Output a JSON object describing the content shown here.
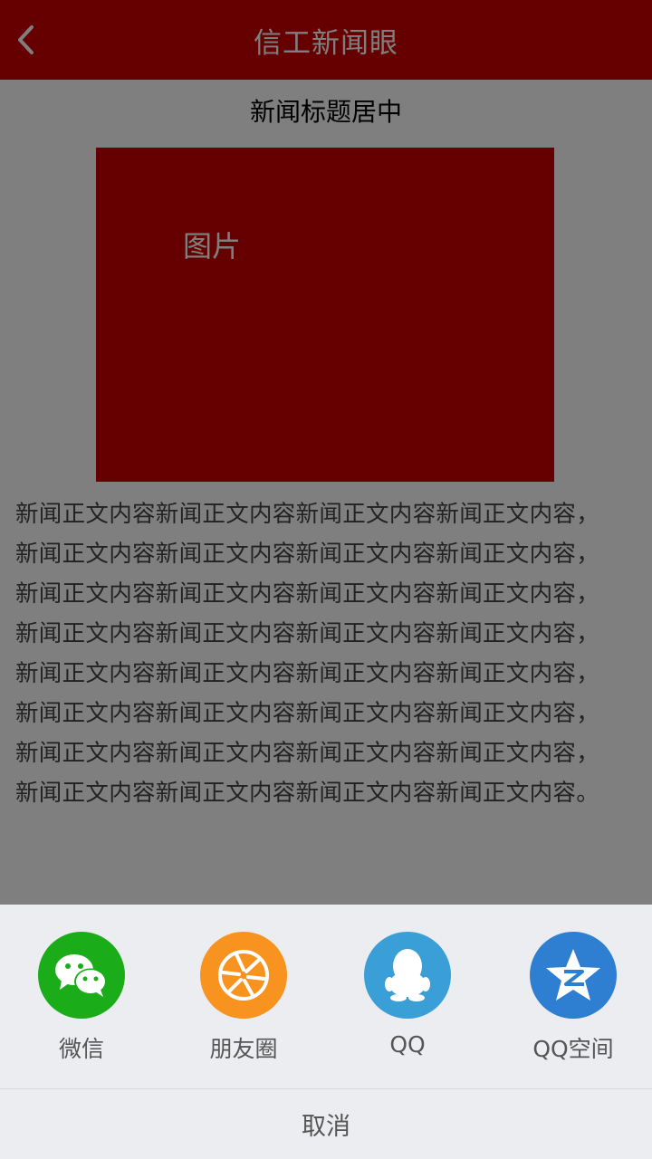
{
  "header": {
    "title": "信工新闻眼",
    "back_icon": "chevron-left-icon"
  },
  "article": {
    "title": "新闻标题居中",
    "image_label": "图片",
    "body_lines": [
      "新闻正文内容新闻正文内容新闻正文内容新闻正文内容，",
      "新闻正文内容新闻正文内容新闻正文内容新闻正文内容，",
      "新闻正文内容新闻正文内容新闻正文内容新闻正文内容，",
      "新闻正文内容新闻正文内容新闻正文内容新闻正文内容，",
      "新闻正文内容新闻正文内容新闻正文内容新闻正文内容，",
      "新闻正文内容新闻正文内容新闻正文内容新闻正文内容，",
      "新闻正文内容新闻正文内容新闻正文内容新闻正文内容，",
      "新闻正文内容新闻正文内容新闻正文内容新闻正文内容。"
    ]
  },
  "share_sheet": {
    "items": [
      {
        "label": "微信",
        "icon": "wechat-icon",
        "color": "#1aad19"
      },
      {
        "label": "朋友圈",
        "icon": "moments-icon",
        "color": "#f7931e"
      },
      {
        "label": "QQ",
        "icon": "qq-icon",
        "color": "#3a9fd6"
      },
      {
        "label": "QQ空间",
        "icon": "qzone-icon",
        "color": "#2e7fd1"
      }
    ],
    "cancel_label": "取消"
  },
  "colors": {
    "brand_red": "#cc0000",
    "overlay": "rgba(0,0,0,0.5)",
    "sheet_bg": "#ebedf0"
  }
}
